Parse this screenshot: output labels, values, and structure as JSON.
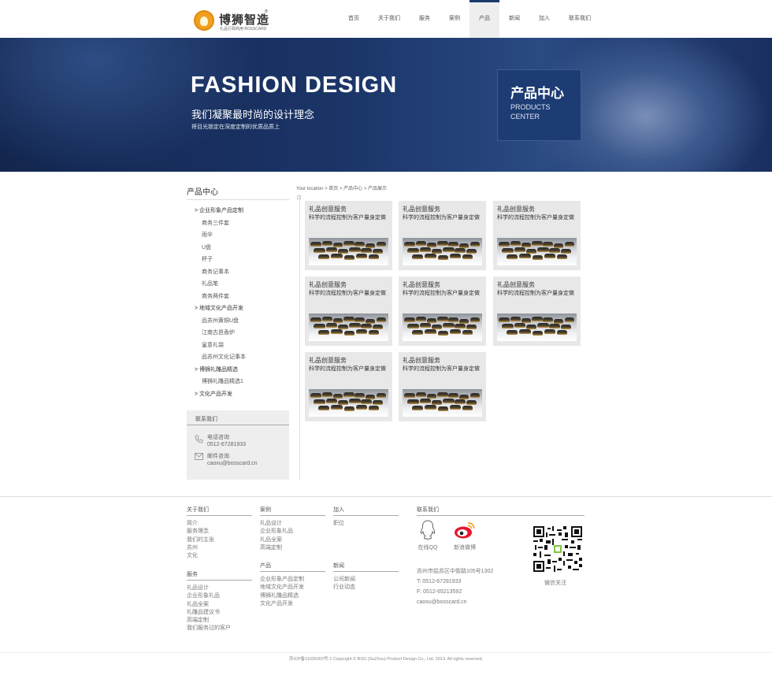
{
  "header": {
    "logo_text": "博狮智造",
    "logo_sub": "礼品行政商用 BOSSCARD",
    "reg_mark": "®",
    "nav": [
      "首页",
      "关于我们",
      "服务",
      "案例",
      "产品",
      "新闻",
      "加入",
      "联系我们"
    ],
    "active_nav": "产品"
  },
  "banner": {
    "title": "FASHION DESIGN",
    "slogan": "我们凝聚最时尚的设计理念",
    "small": "将目光锁定在深度定制的优质品质上",
    "box_cn": "产品中心",
    "box_en": "PRODUCTS CENTER"
  },
  "sidebar": {
    "title": "产品中心",
    "categories": [
      {
        "label": "企业形象产品定制",
        "level": 1
      },
      {
        "label": "商务三件套",
        "level": 2
      },
      {
        "label": "雨伞",
        "level": 2
      },
      {
        "label": "U盘",
        "level": 2
      },
      {
        "label": "杯子",
        "level": 2
      },
      {
        "label": "商务记事本",
        "level": 2
      },
      {
        "label": "礼品笔",
        "level": 2
      },
      {
        "label": "商务两件套",
        "level": 2
      },
      {
        "label": "地域文化产品开发",
        "level": 1
      },
      {
        "label": "品苏州黄铜U盘",
        "level": 2
      },
      {
        "label": "江南古邑香炉",
        "level": 2
      },
      {
        "label": "皇意礼袋",
        "level": 2
      },
      {
        "label": "品苏州文化记事本",
        "level": 2
      },
      {
        "label": "博狮礼雕品精选",
        "level": 1
      },
      {
        "label": "博狮礼雕品精选1",
        "level": 2
      },
      {
        "label": "文化产品开发",
        "level": 1
      }
    ],
    "contact": {
      "title": "联系我们",
      "phone_label": "电话咨询",
      "phone": "0512-67281933",
      "email_label": "邮件咨询",
      "email": "caoxu@bosscard.cn"
    }
  },
  "main": {
    "breadcrumb": "Your location > 首页 > 产品中心 > 产品展示",
    "products": [
      {
        "title": "礼品创意服务",
        "desc": "科学的流程控制为客户量身定做"
      },
      {
        "title": "礼品创意服务",
        "desc": "科学的流程控制为客户量身定做"
      },
      {
        "title": "礼品创意服务",
        "desc": "科学的流程控制为客户量身定做"
      },
      {
        "title": "礼品创意服务",
        "desc": "科学的流程控制为客户量身定做"
      },
      {
        "title": "礼品创意服务",
        "desc": "科学的流程控制为客户量身定做"
      },
      {
        "title": "礼品创意服务",
        "desc": "科学的流程控制为客户量身定做"
      },
      {
        "title": "礼品创意服务",
        "desc": "科学的流程控制为客户量身定做"
      },
      {
        "title": "礼品创意服务",
        "desc": "科学的流程控制为客户量身定做"
      }
    ]
  },
  "footer": {
    "about": {
      "title": "关于我们",
      "links": [
        "简介",
        "服务理念",
        "我们的主张",
        "苏州",
        "文化"
      ]
    },
    "services": {
      "title": "服务",
      "links": [
        "礼品设计",
        "企业形象礼品",
        "礼品全案",
        "礼雕品建议书",
        "高端定制",
        "我们服务过的客户"
      ]
    },
    "cases": {
      "title": "案例",
      "links": [
        "礼品设计",
        "企业形象礼品",
        "礼品全案",
        "高端定制"
      ]
    },
    "products": {
      "title": "产品",
      "links": [
        "企业形象产品定制",
        "地域文化产品开发",
        "博狮礼雕品精选",
        "文化产品开发"
      ]
    },
    "join": {
      "title": "加入",
      "links": [
        "职位"
      ]
    },
    "news": {
      "title": "新闻",
      "links": [
        "公司新闻",
        "行业动态"
      ]
    },
    "contact": {
      "title": "联系我们",
      "qq_label": "在线QQ",
      "weibo_label": "新浪微博",
      "address": "苏州市姑苏区中街路105号1302",
      "tel": "T: 0512-67281933",
      "fax": "F: 0512-65213592",
      "email": "caoxu@bosscard.cn",
      "qr_label": "微信关注"
    },
    "copyright": "苏ICP备11030303号-1  Copyright © BSG (SuZhou) Product Design Co., Ltd. 2013. All rights reserved."
  },
  "colors": {
    "accent": "#1c3a6b",
    "banner_box": "#1d3c73",
    "weibo_red": "#e6162d"
  }
}
